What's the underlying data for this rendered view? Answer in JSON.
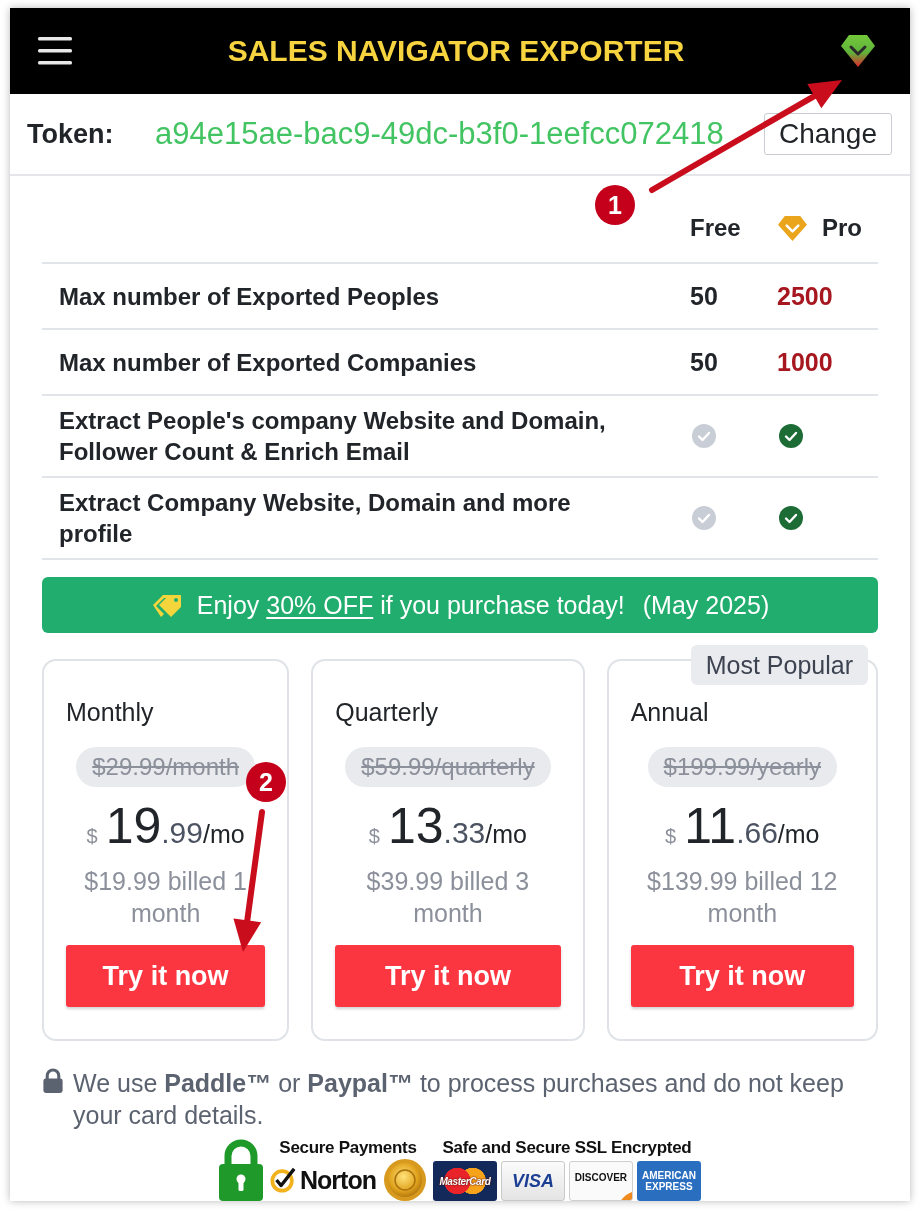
{
  "header": {
    "title": "SALES NAVIGATOR EXPORTER"
  },
  "token": {
    "label": "Token:",
    "value": "a94e15ae-bac9-49dc-b3f0-1eefcc072418",
    "button": "Change"
  },
  "comparison": {
    "columns": [
      {
        "label": "Free",
        "premium": false
      },
      {
        "label": "Pro",
        "premium": true
      }
    ],
    "rows": [
      {
        "feature": "Max number of Exported Peoples",
        "cells": [
          {
            "kind": "text",
            "text": "50"
          },
          {
            "kind": "text",
            "text": "2500"
          }
        ]
      },
      {
        "feature": "Max number of Exported Companies",
        "cells": [
          {
            "kind": "text",
            "text": "50"
          },
          {
            "kind": "text",
            "text": "1000"
          }
        ]
      },
      {
        "feature": "Extract People's company Website and Domain, Follower Count & Enrich Email",
        "cells": [
          {
            "kind": "check",
            "included": false
          },
          {
            "kind": "check",
            "included": true
          }
        ]
      },
      {
        "feature": "Extract Company Website, Domain and more profile",
        "cells": [
          {
            "kind": "check",
            "included": false
          },
          {
            "kind": "check",
            "included": true
          }
        ]
      }
    ]
  },
  "promo": {
    "before": "Enjoy ",
    "highlight": "30% OFF",
    "after": " if you purchase today!",
    "note": "(May 2025)"
  },
  "plans": [
    {
      "name": "Monthly",
      "old_price": "$29.99/month",
      "currency": "$",
      "price_whole": "19",
      "price_cents": ".99",
      "period": "/mo",
      "billing": "$19.99 billed 1 month",
      "button": "Try it now"
    },
    {
      "name": "Quarterly",
      "old_price": "$59.99/quarterly",
      "currency": "$",
      "price_whole": "13",
      "price_cents": ".33",
      "period": "/mo",
      "billing": "$39.99 billed 3 month",
      "button": "Try it now"
    },
    {
      "name": "Annual",
      "badge": "Most Popular",
      "old_price": "$199.99/yearly",
      "currency": "$",
      "price_whole": "11",
      "price_cents": ".66",
      "period": "/mo",
      "billing": "$139.99 billed 12 month",
      "button": "Try it now"
    }
  ],
  "security_note": "We use **Paddle™** or **Paypal™** to process purchases and do not keep your card details.",
  "trust_badges": {
    "secure_title": "Secure Payments",
    "norton": "Norton",
    "ssl_title": "Safe and Secure SSL Encrypted",
    "cards": [
      {
        "kind": "mastercard",
        "label": "MasterCard"
      },
      {
        "kind": "visa",
        "label": "VISA"
      },
      {
        "kind": "discover",
        "label": "DISCOVER"
      },
      {
        "kind": "amex",
        "label": "AMERICAN EXPRESS"
      }
    ]
  },
  "annotations": [
    {
      "label": "1"
    },
    {
      "label": "2"
    }
  ]
}
